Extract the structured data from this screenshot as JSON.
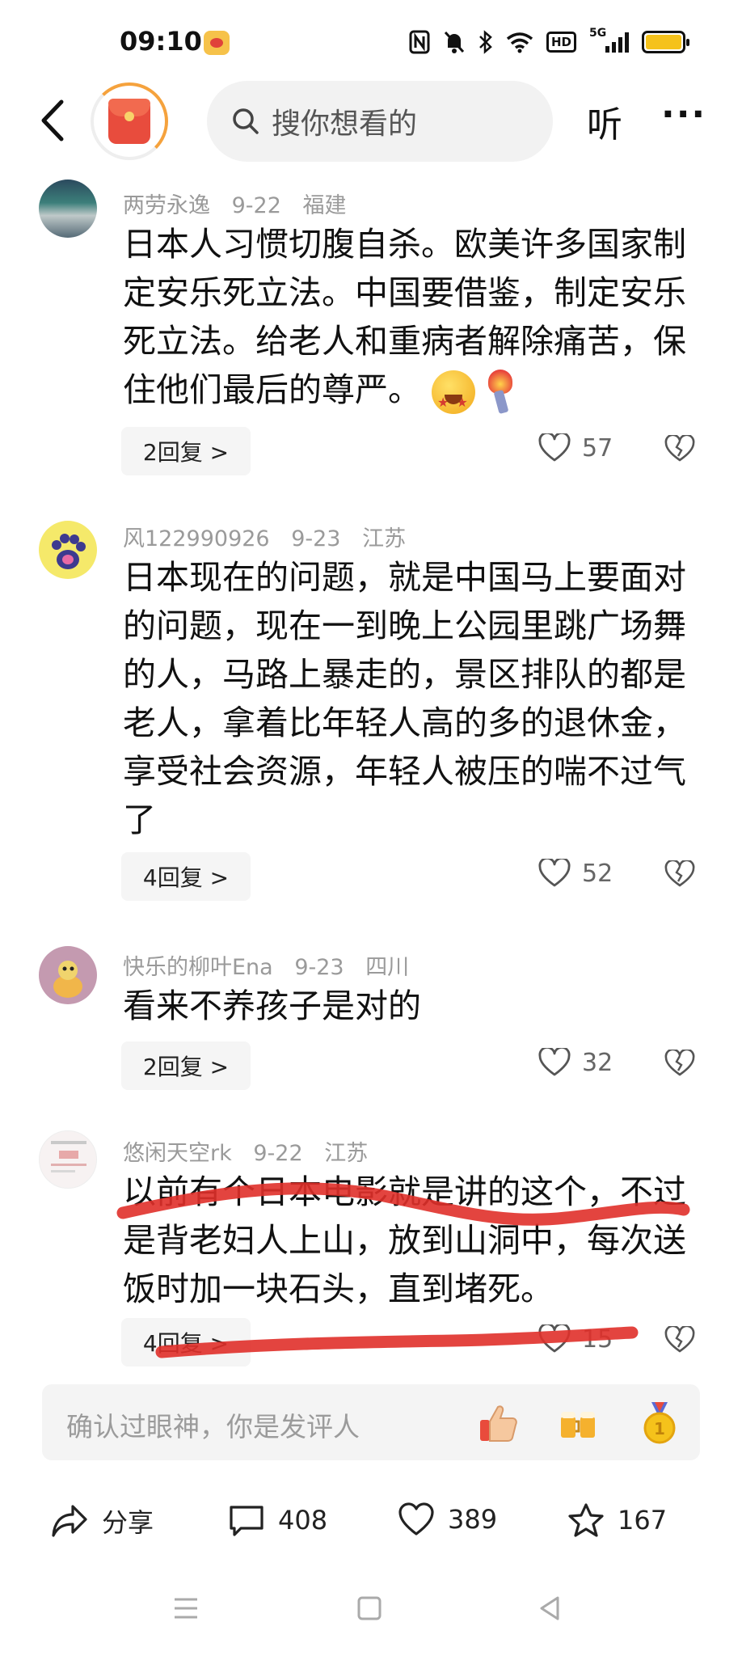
{
  "status_bar": {
    "time": "09:10",
    "hd_label": "HD",
    "net_label": "5G"
  },
  "nav": {
    "search_placeholder": "搜你想看的",
    "listen_label": "听",
    "more_label": "···"
  },
  "comments": [
    {
      "username": "两劳永逸",
      "date": "9-22",
      "location": "福建",
      "text": "日本人习惯切腹自杀。欧美许多国家制定安乐死立法。中国要借鉴，制定安乐死立法。给老人和重病者解除痛苦，保住他们最后的尊严。",
      "emojis": [
        "star-eyes-emoji",
        "torch-emoji"
      ],
      "replies_label": "2回复 >",
      "likes": "57"
    },
    {
      "username": "风122990926",
      "date": "9-23",
      "location": "江苏",
      "text": "日本现在的问题，就是中国马上要面对的问题，现在一到晚上公园里跳广场舞的人，马路上暴走的，景区排队的都是老人，拿着比年轻人高的多的退休金，享受社会资源，年轻人被压的喘不过气了",
      "replies_label": "4回复 >",
      "likes": "52"
    },
    {
      "username": "快乐的柳叶Ena",
      "date": "9-23",
      "location": "四川",
      "text": "看来不养孩子是对的",
      "replies_label": "2回复 >",
      "likes": "32"
    },
    {
      "username": "悠闲天空rk",
      "date": "9-22",
      "location": "江苏",
      "text": "以前有个日本电影就是讲的这个，不过是背老妇人上山，放到山洞中，每次送饭时加一块石头，直到堵死。",
      "replies_label": "4回复 >",
      "likes": "15",
      "annotation_color": "#e0302a"
    }
  ],
  "input_bar": {
    "placeholder": "确认过眼神，你是发评人"
  },
  "actions": {
    "share_label": "分享",
    "comments_count": "408",
    "likes_count": "389",
    "favorites_count": "167"
  },
  "colors": {
    "accent_red": "#e84c3d",
    "meta_gray": "#9a9a9a",
    "annotation_red": "#e0302a"
  }
}
